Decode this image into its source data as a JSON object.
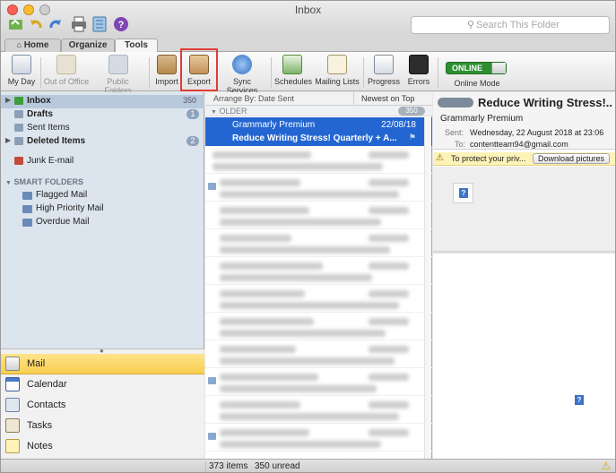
{
  "window": {
    "title": "Inbox"
  },
  "search": {
    "placeholder": "Search This Folder",
    "icon": "magnifier-icon"
  },
  "ribbon_tabs": [
    {
      "label": "Home",
      "icon": "home-icon"
    },
    {
      "label": "Organize"
    },
    {
      "label": "Tools",
      "active": true
    }
  ],
  "ribbon": {
    "my_day": "My Day",
    "out_of_office": "Out of Office",
    "public_folders": "Public Folders",
    "import": "Import",
    "export": "Export",
    "sync_services": "Sync Services",
    "schedules": "Schedules",
    "mailing_lists": "Mailing Lists",
    "progress": "Progress",
    "errors": "Errors",
    "online_toggle": "ONLINE",
    "online_mode": "Online Mode"
  },
  "folders": {
    "inbox": {
      "label": "Inbox",
      "count": "350"
    },
    "drafts": {
      "label": "Drafts",
      "count": "1"
    },
    "sent": {
      "label": "Sent Items"
    },
    "deleted": {
      "label": "Deleted Items",
      "count": "2"
    },
    "junk": {
      "label": "Junk E-mail"
    }
  },
  "smart_folders": {
    "heading": "SMART FOLDERS",
    "items": [
      "Flagged Mail",
      "High Priority Mail",
      "Overdue Mail"
    ]
  },
  "nav": {
    "mail": "Mail",
    "calendar": "Calendar",
    "contacts": "Contacts",
    "tasks": "Tasks",
    "notes": "Notes"
  },
  "list": {
    "arrange_label": "Arrange By: Date Sent",
    "sort_label": "Newest on Top",
    "group_label": "OLDER",
    "group_count": "350",
    "selected": {
      "sender": "Grammarly Premium",
      "date": "22/08/18",
      "subject": "Reduce Writing Stress! Quarterly + A..."
    }
  },
  "reading": {
    "subject": "Reduce Writing Stress!...",
    "from": "Grammarly Premium",
    "sent_label": "Sent:",
    "sent_value": "Wednesday, 22 August 2018 at 23:06",
    "to_label": "To:",
    "to_value": "contentteam94@gmail.com",
    "protect_text": "To protect your priv...",
    "download_label": "Download pictures",
    "image_placeholder": "?"
  },
  "status": {
    "items": "373 items",
    "unread": "350 unread",
    "warning_icon": "warning-icon"
  },
  "colors": {
    "accent_selected": "#2366d1",
    "online_green": "#2e8f30",
    "highlight_red": "#e23a35",
    "nav_active": "#f8cf4f",
    "sidebar_bg": "#dce5ee"
  }
}
